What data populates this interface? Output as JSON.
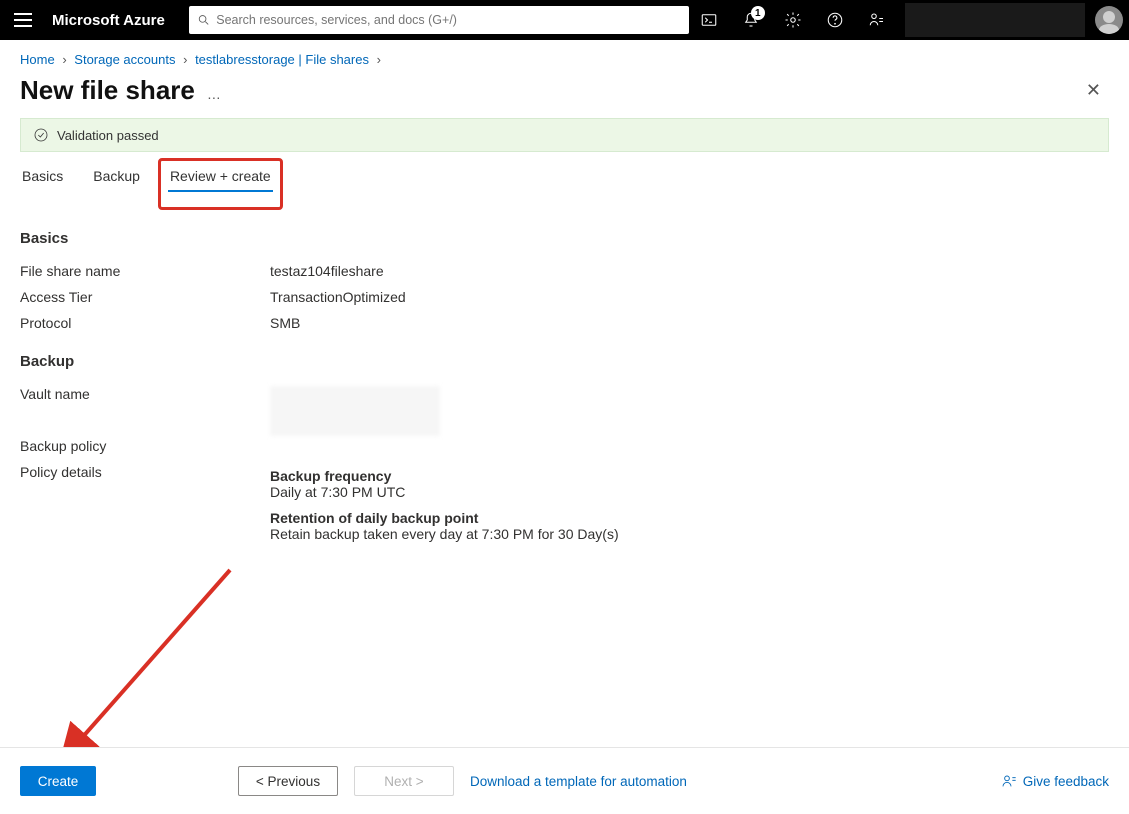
{
  "topbar": {
    "brand": "Microsoft Azure",
    "search_placeholder": "Search resources, services, and docs (G+/)",
    "notification_count": "1"
  },
  "breadcrumb": {
    "items": [
      "Home",
      "Storage accounts",
      "testlabresstorage | File shares"
    ]
  },
  "title": {
    "text": "New file share",
    "more": "…"
  },
  "validation": {
    "text": "Validation passed"
  },
  "tabs": {
    "items": [
      "Basics",
      "Backup",
      "Review + create"
    ],
    "active": 2
  },
  "sections": {
    "basics": {
      "heading": "Basics",
      "rows": [
        {
          "k": "File share name",
          "v": "testaz104fileshare"
        },
        {
          "k": "Access Tier",
          "v": "TransactionOptimized"
        },
        {
          "k": "Protocol",
          "v": "SMB"
        }
      ]
    },
    "backup": {
      "heading": "Backup",
      "vault_label": "Vault name",
      "policy_label": "Backup policy",
      "details_label": "Policy details",
      "freq_h": "Backup frequency",
      "freq_v": "Daily at 7:30 PM UTC",
      "ret_h": "Retention of daily backup point",
      "ret_v": "Retain backup taken every day at 7:30 PM for 30 Day(s)"
    }
  },
  "bottom": {
    "create": "Create",
    "previous": "<  Previous",
    "next": "Next  >",
    "download": "Download a template for automation",
    "feedback": "Give feedback"
  }
}
